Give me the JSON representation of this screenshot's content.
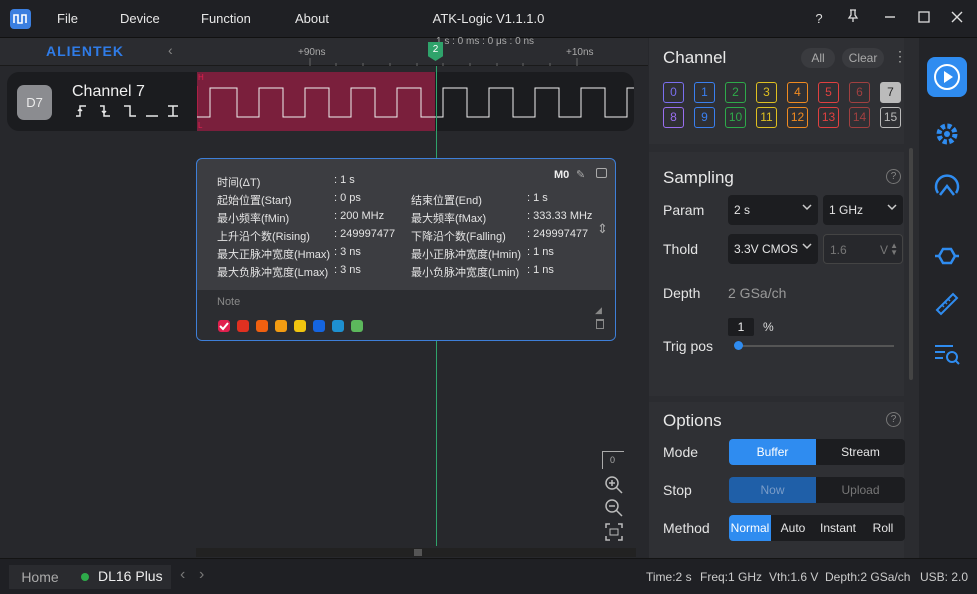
{
  "app": {
    "title": "ATK-Logic  V1.1.1.0",
    "menu": [
      "File",
      "Device",
      "Function",
      "About"
    ],
    "help": "?"
  },
  "ruler": {
    "brand": "ALIENTEK",
    "tick_left": "+90ns",
    "tick_right": "+10ns",
    "cursor_label": "1 s : 0 ms : 0 μs : 0 ns",
    "marker": "2"
  },
  "channel": {
    "badge": "D7",
    "name": "Channel 7",
    "high": "H",
    "low": "L"
  },
  "measure": {
    "id": "M0",
    "rows": [
      {
        "l": "时间(ΔT)",
        "lv": ": 1 s",
        "r": "",
        "rv": ""
      },
      {
        "l": "起始位置(Start)",
        "lv": ": 0 ps",
        "r": "结束位置(End)",
        "rv": ": 1 s"
      },
      {
        "l": "最小频率(fMin)",
        "lv": ": 200 MHz",
        "r": "最大频率(fMax)",
        "rv": ": 333.33 MHz"
      },
      {
        "l": "上升沿个数(Rising)",
        "lv": ": 249997477",
        "r": "下降沿个数(Falling)",
        "rv": ": 249997477"
      },
      {
        "l": "最大正脉冲宽度(Hmax)",
        "lv": ": 3 ns",
        "r": "最小正脉冲宽度(Hmin)",
        "rv": ": 1 ns"
      },
      {
        "l": "最大负脉冲宽度(Lmax)",
        "lv": ": 3 ns",
        "r": "最小负脉冲宽度(Lmin)",
        "rv": ": 1 ns"
      }
    ],
    "note_placeholder": "Note",
    "colors": [
      "#e0204e",
      "#e03020",
      "#f06010",
      "#f39c12",
      "#f1c40f",
      "#1565e0",
      "#1e90d0",
      "#5cb85c"
    ]
  },
  "channels_panel": {
    "title": "Channel",
    "all": "All",
    "clear": "Clear",
    "row1": [
      {
        "n": "0",
        "c": "#7a6ff0"
      },
      {
        "n": "1",
        "c": "#3a7ff0"
      },
      {
        "n": "2",
        "c": "#2eaa4a"
      },
      {
        "n": "3",
        "c": "#e0c020"
      },
      {
        "n": "4",
        "c": "#f08a20"
      },
      {
        "n": "5",
        "c": "#e04040"
      },
      {
        "n": "6",
        "c": "#a04040"
      },
      {
        "n": "7",
        "c": "#bbbbbb"
      }
    ],
    "row2": [
      {
        "n": "8",
        "c": "#9a6ff0"
      },
      {
        "n": "9",
        "c": "#3a7ff0"
      },
      {
        "n": "10",
        "c": "#2eaa4a"
      },
      {
        "n": "11",
        "c": "#e0c020"
      },
      {
        "n": "12",
        "c": "#f08a20"
      },
      {
        "n": "13",
        "c": "#e04040"
      },
      {
        "n": "14",
        "c": "#a04040"
      },
      {
        "n": "15",
        "c": "#bbbbbb"
      }
    ]
  },
  "sampling": {
    "title": "Sampling",
    "param_label": "Param",
    "param_time": "2 s",
    "param_rate": "1 GHz",
    "thold_label": "Thold",
    "thold_value": "3.3V CMOS",
    "thold_volt": "1.6",
    "volt_unit": "V",
    "depth_label": "Depth",
    "depth_value": "2 GSa/ch",
    "trig_label": "Trig pos",
    "trig_value": "1",
    "trig_unit": "%",
    "trig_percent": 1
  },
  "options": {
    "title": "Options",
    "mode_label": "Mode",
    "mode": [
      "Buffer",
      "Stream"
    ],
    "stop_label": "Stop",
    "stop": [
      "Now",
      "Upload"
    ],
    "method_label": "Method",
    "method": [
      "Normal",
      "Auto",
      "Instant",
      "Roll"
    ]
  },
  "status": {
    "home": "Home",
    "device": "DL16 Plus",
    "time": "Time:2 s",
    "freq": "Freq:1 GHz",
    "vth": "Vth:1.6 V",
    "depth": "Depth:2 GSa/ch",
    "usb": "USB: 2.0"
  },
  "zoom": {
    "reset_label": "0"
  }
}
